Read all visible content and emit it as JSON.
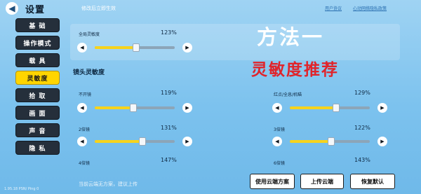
{
  "header": {
    "back_icon": "chevron-left-icon",
    "title": "设置",
    "subtitle": "修改后立即生效",
    "link_privacy": "用户协议",
    "link_policy": "心动网络隐私政策"
  },
  "sidebar": {
    "items": [
      {
        "label": "基 础",
        "active": false
      },
      {
        "label": "操作模式",
        "active": false
      },
      {
        "label": "载 具",
        "active": false
      },
      {
        "label": "灵敏度",
        "active": true
      },
      {
        "label": "拾 取",
        "active": false
      },
      {
        "label": "画 面",
        "active": false
      },
      {
        "label": "声 音",
        "active": false
      },
      {
        "label": "隐 私",
        "active": false
      }
    ]
  },
  "version_text": "1.95.18 PSN/ Ping 0",
  "global": {
    "label": "全局灵敏度",
    "value": "123%",
    "level_percent": 52
  },
  "section_title": "镜头灵敏度",
  "sliders": [
    {
      "label": "不开镜",
      "value": "119%",
      "level_percent": 48
    },
    {
      "label": "红点/全息/机瞄",
      "value": "129%",
      "level_percent": 58
    },
    {
      "label": "2倍镜",
      "value": "131%",
      "level_percent": 60
    },
    {
      "label": "3倍镜",
      "value": "122%",
      "level_percent": 52
    },
    {
      "label": "4倍镜",
      "value": "147%"
    },
    {
      "label": "6倍镜",
      "value": "143%"
    }
  ],
  "overlay": {
    "line1": "方法一",
    "line2": "灵敏度推荐"
  },
  "footer": {
    "note": "当前云端无方案，建议上传",
    "btn_use_cloud": "使用云端方案",
    "btn_upload": "上传云端",
    "btn_restore": "恢复默认"
  },
  "colors": {
    "accent_fill": "#f7d31c",
    "active_tab": "#ffd500",
    "sidebar_bg": "#252f3b",
    "overlay_red": "#e0242b"
  }
}
